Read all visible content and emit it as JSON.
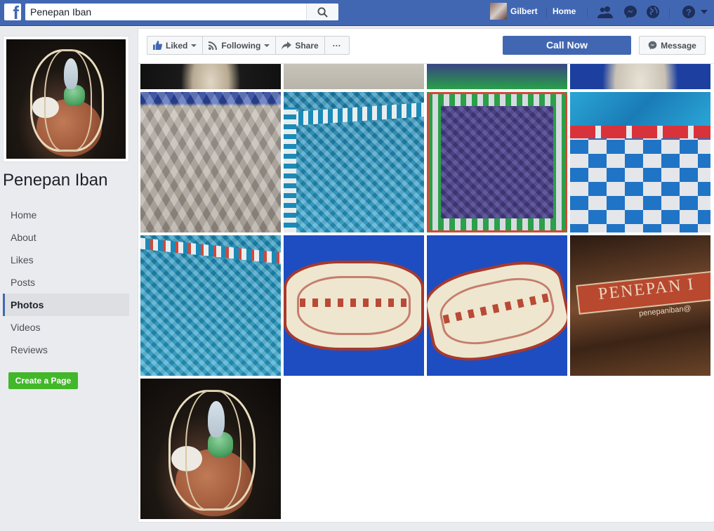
{
  "topbar": {
    "search_value": "Penepan Iban",
    "user_name": "Gilbert",
    "home_label": "Home",
    "icons": [
      "friend-requests-icon",
      "messenger-icon",
      "notifications-globe-icon",
      "help-icon"
    ],
    "brand_color": "#4267b2"
  },
  "page": {
    "name": "Penepan Iban"
  },
  "sidebar": {
    "items": [
      {
        "label": "Home",
        "active": false
      },
      {
        "label": "About",
        "active": false
      },
      {
        "label": "Likes",
        "active": false
      },
      {
        "label": "Posts",
        "active": false
      },
      {
        "label": "Photos",
        "active": true
      },
      {
        "label": "Videos",
        "active": false
      },
      {
        "label": "Reviews",
        "active": false
      }
    ],
    "create_page_label": "Create a Page"
  },
  "actions": {
    "liked_label": "Liked",
    "following_label": "Following",
    "share_label": "Share",
    "more_label": "···",
    "call_now_label": "Call Now",
    "message_label": "Message"
  },
  "photos": {
    "wood_sign_text": "PENEPAN I",
    "wood_sign_subtext": "penepaniban@"
  },
  "colors": {
    "accent": "#4267b2",
    "create_page_green": "#42b72a",
    "background": "#e9ebee"
  }
}
